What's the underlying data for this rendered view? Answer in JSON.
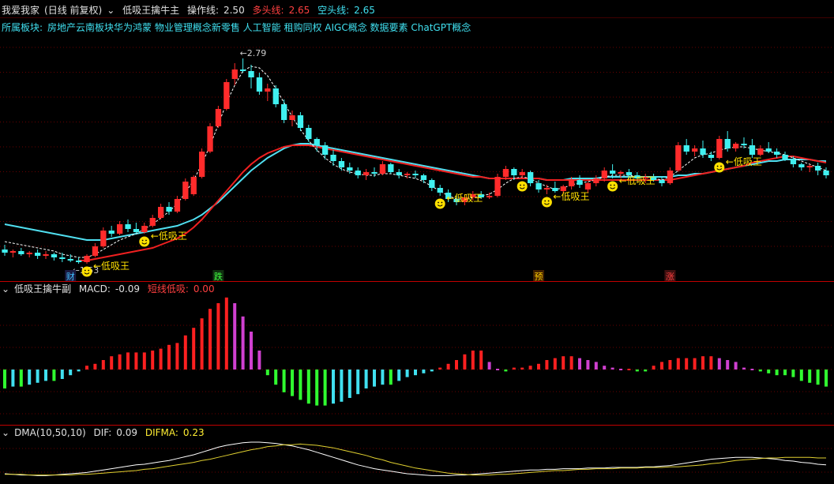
{
  "header": {
    "stock_name": "我爱我家",
    "period": "(日线 前复权)",
    "indicator_name": "低吸王擒牛主",
    "op_label": "操作线:",
    "op_value": "2.50",
    "bull_label": "多头线:",
    "bull_value": "2.65",
    "bear_label": "空头线:",
    "bear_value": "2.65"
  },
  "concepts": {
    "label": "所属板块:",
    "items": "房地产云南板块华为鸿蒙 物业管理概念新零售 人工智能 租购同权 AIGC概念 数据要素 ChatGPT概念"
  },
  "colors": {
    "up": "#ff2b2b",
    "down": "#40f0f0",
    "grid": "#8b0000",
    "bull_line": "#f02020",
    "bear_line": "#50dff0",
    "signal": "#ffe000",
    "macd_pos_strong": "#ff2020",
    "macd_pos_weak": "#d040d0",
    "macd_neg_strong": "#30ff30",
    "macd_neg_weak": "#40e0f0"
  },
  "sub1": {
    "title": "低吸王擒牛副",
    "macd_label": "MACD:",
    "macd_value": "-0.09",
    "short_label": "短线低吸:",
    "short_value": "0.00"
  },
  "sub2": {
    "title": "DMA(10,50,10)",
    "dif_label": "DIF:",
    "dif_value": "0.09",
    "difma_label": "DIFMA:",
    "difma_value": "0.23"
  },
  "chart_data": {
    "type": "candlestick",
    "price_range": [
      1.45,
      2.95
    ],
    "max_label": "2.79",
    "min_label": "1.53",
    "candles": [
      [
        1.58,
        1.61,
        1.54,
        1.56
      ],
      [
        1.56,
        1.58,
        1.53,
        1.57
      ],
      [
        1.57,
        1.59,
        1.54,
        1.55
      ],
      [
        1.55,
        1.57,
        1.53,
        1.56
      ],
      [
        1.56,
        1.58,
        1.52,
        1.54
      ],
      [
        1.54,
        1.57,
        1.52,
        1.55
      ],
      [
        1.55,
        1.56,
        1.51,
        1.53
      ],
      [
        1.53,
        1.56,
        1.5,
        1.52
      ],
      [
        1.52,
        1.55,
        1.5,
        1.51
      ],
      [
        1.51,
        1.53,
        1.49,
        1.5
      ],
      [
        1.5,
        1.55,
        1.49,
        1.54
      ],
      [
        1.54,
        1.62,
        1.53,
        1.6
      ],
      [
        1.6,
        1.72,
        1.59,
        1.7
      ],
      [
        1.7,
        1.73,
        1.66,
        1.68
      ],
      [
        1.68,
        1.76,
        1.67,
        1.74
      ],
      [
        1.74,
        1.77,
        1.69,
        1.71
      ],
      [
        1.71,
        1.75,
        1.68,
        1.69
      ],
      [
        1.69,
        1.75,
        1.68,
        1.73
      ],
      [
        1.73,
        1.8,
        1.72,
        1.78
      ],
      [
        1.78,
        1.87,
        1.77,
        1.85
      ],
      [
        1.85,
        1.88,
        1.8,
        1.82
      ],
      [
        1.82,
        1.92,
        1.81,
        1.9
      ],
      [
        1.9,
        2.03,
        1.89,
        2.01
      ],
      [
        1.93,
        2.05,
        1.92,
        2.04
      ],
      [
        2.04,
        2.22,
        2.03,
        2.2
      ],
      [
        2.2,
        2.38,
        2.19,
        2.36
      ],
      [
        2.36,
        2.49,
        2.35,
        2.47
      ],
      [
        2.47,
        2.66,
        2.46,
        2.64
      ],
      [
        2.66,
        2.76,
        2.62,
        2.72
      ],
      [
        2.72,
        2.79,
        2.7,
        2.71
      ],
      [
        2.71,
        2.75,
        2.6,
        2.67
      ],
      [
        2.67,
        2.7,
        2.56,
        2.58
      ],
      [
        2.58,
        2.63,
        2.52,
        2.6
      ],
      [
        2.6,
        2.62,
        2.48,
        2.5
      ],
      [
        2.5,
        2.53,
        2.38,
        2.4
      ],
      [
        2.4,
        2.46,
        2.36,
        2.43
      ],
      [
        2.43,
        2.45,
        2.33,
        2.35
      ],
      [
        2.35,
        2.37,
        2.26,
        2.28
      ],
      [
        2.28,
        2.29,
        2.2,
        2.24
      ],
      [
        2.24,
        2.26,
        2.15,
        2.18
      ],
      [
        2.18,
        2.21,
        2.11,
        2.14
      ],
      [
        2.14,
        2.16,
        2.08,
        2.1
      ],
      [
        2.1,
        2.13,
        2.06,
        2.08
      ],
      [
        2.08,
        2.1,
        2.03,
        2.05
      ],
      [
        2.05,
        2.09,
        2.02,
        2.07
      ],
      [
        2.07,
        2.1,
        2.04,
        2.06
      ],
      [
        2.06,
        2.14,
        2.05,
        2.12
      ],
      [
        2.12,
        2.13,
        2.06,
        2.07
      ],
      [
        2.07,
        2.09,
        2.03,
        2.05
      ],
      [
        2.05,
        2.07,
        2.03,
        2.06
      ],
      [
        2.06,
        2.08,
        2.03,
        2.05
      ],
      [
        2.05,
        2.06,
        2.0,
        2.02
      ],
      [
        2.02,
        2.03,
        1.95,
        1.97
      ],
      [
        1.97,
        1.99,
        1.92,
        1.94
      ],
      [
        1.94,
        1.96,
        1.88,
        1.9
      ],
      [
        1.9,
        1.92,
        1.86,
        1.88
      ],
      [
        1.88,
        1.93,
        1.86,
        1.91
      ],
      [
        1.91,
        1.95,
        1.89,
        1.93
      ],
      [
        1.93,
        1.95,
        1.9,
        1.91
      ],
      [
        1.91,
        1.94,
        1.9,
        1.92
      ],
      [
        1.92,
        2.06,
        1.91,
        2.04
      ],
      [
        2.04,
        2.11,
        2.02,
        2.09
      ],
      [
        2.09,
        2.1,
        2.02,
        2.05
      ],
      [
        2.05,
        2.09,
        2.03,
        2.07
      ],
      [
        2.07,
        2.08,
        1.98,
        2.0
      ],
      [
        2.0,
        2.02,
        1.94,
        1.96
      ],
      [
        1.96,
        1.99,
        1.93,
        1.97
      ],
      [
        1.97,
        2.01,
        1.94,
        1.95
      ],
      [
        1.95,
        1.99,
        1.93,
        1.98
      ],
      [
        1.98,
        2.04,
        1.96,
        2.02
      ],
      [
        2.02,
        2.05,
        1.97,
        1.99
      ],
      [
        1.96,
        2.01,
        1.94,
        2.0
      ],
      [
        2.0,
        2.05,
        1.98,
        2.03
      ],
      [
        2.03,
        2.1,
        2.01,
        2.08
      ],
      [
        2.08,
        2.12,
        2.03,
        2.06
      ],
      [
        2.06,
        2.08,
        2.03,
        2.07
      ],
      [
        2.07,
        2.09,
        2.03,
        2.05
      ],
      [
        2.05,
        2.07,
        2.01,
        2.03
      ],
      [
        2.03,
        2.06,
        2.0,
        2.04
      ],
      [
        2.04,
        2.06,
        2.01,
        2.02
      ],
      [
        2.02,
        2.04,
        1.98,
        2.0
      ],
      [
        2.0,
        2.1,
        1.99,
        2.08
      ],
      [
        2.08,
        2.26,
        2.07,
        2.24
      ],
      [
        2.24,
        2.28,
        2.18,
        2.2
      ],
      [
        2.2,
        2.24,
        2.17,
        2.22
      ],
      [
        2.22,
        2.27,
        2.16,
        2.18
      ],
      [
        2.18,
        2.2,
        2.14,
        2.16
      ],
      [
        2.16,
        2.3,
        2.15,
        2.28
      ],
      [
        2.28,
        2.33,
        2.2,
        2.22
      ],
      [
        2.22,
        2.26,
        2.2,
        2.25
      ],
      [
        2.25,
        2.29,
        2.22,
        2.24
      ],
      [
        2.24,
        2.28,
        2.16,
        2.18
      ],
      [
        2.18,
        2.24,
        2.17,
        2.22
      ],
      [
        2.22,
        2.26,
        2.19,
        2.2
      ],
      [
        2.2,
        2.22,
        2.16,
        2.18
      ],
      [
        2.18,
        2.2,
        2.14,
        2.15
      ],
      [
        2.15,
        2.17,
        2.1,
        2.12
      ],
      [
        2.12,
        2.13,
        2.08,
        2.1
      ],
      [
        2.1,
        2.12,
        2.07,
        2.11
      ],
      [
        2.11,
        2.13,
        2.05,
        2.08
      ],
      [
        2.08,
        2.1,
        2.03,
        2.05
      ]
    ],
    "bear_line": [
      1.74,
      1.73,
      1.72,
      1.71,
      1.7,
      1.69,
      1.68,
      1.67,
      1.66,
      1.65,
      1.64,
      1.64,
      1.64,
      1.65,
      1.66,
      1.67,
      1.68,
      1.69,
      1.7,
      1.71,
      1.72,
      1.73,
      1.75,
      1.77,
      1.8,
      1.84,
      1.88,
      1.93,
      1.98,
      2.03,
      2.08,
      2.12,
      2.16,
      2.19,
      2.22,
      2.24,
      2.25,
      2.25,
      2.24,
      2.23,
      2.22,
      2.21,
      2.2,
      2.19,
      2.18,
      2.17,
      2.16,
      2.15,
      2.14,
      2.13,
      2.12,
      2.11,
      2.1,
      2.09,
      2.08,
      2.07,
      2.06,
      2.05,
      2.04,
      2.03,
      2.03,
      2.03,
      2.03,
      2.03,
      2.03,
      2.03,
      2.02,
      2.02,
      2.02,
      2.03,
      2.03,
      2.03,
      2.03,
      2.04,
      2.04,
      2.04,
      2.04,
      2.04,
      2.04,
      2.04,
      2.04,
      2.04,
      2.05,
      2.05,
      2.06,
      2.06,
      2.07,
      2.08,
      2.09,
      2.1,
      2.11,
      2.12,
      2.13,
      2.14,
      2.14,
      2.15,
      2.15,
      2.15,
      2.15,
      2.14,
      2.14
    ],
    "bull_line": [
      null,
      null,
      null,
      null,
      null,
      null,
      null,
      null,
      null,
      1.51,
      1.51,
      1.52,
      1.53,
      1.54,
      1.55,
      1.56,
      1.57,
      1.58,
      1.59,
      1.61,
      1.63,
      1.65,
      1.68,
      1.72,
      1.77,
      1.83,
      1.89,
      1.95,
      2.01,
      2.07,
      2.12,
      2.16,
      2.19,
      2.21,
      2.23,
      2.24,
      2.24,
      2.24,
      2.23,
      2.22,
      2.21,
      2.2,
      2.19,
      2.18,
      2.17,
      2.16,
      2.15,
      2.14,
      2.13,
      2.12,
      2.11,
      2.1,
      2.09,
      2.08,
      2.07,
      2.06,
      2.05,
      2.04,
      2.04,
      2.03,
      2.03,
      2.03,
      2.03,
      2.03,
      2.03,
      2.03,
      2.02,
      2.02,
      2.02,
      2.02,
      2.02,
      2.02,
      2.02,
      2.02,
      2.02,
      2.02,
      2.02,
      2.02,
      2.02,
      2.02,
      2.02,
      2.02,
      2.03,
      2.04,
      2.05,
      2.06,
      2.07,
      2.08,
      2.09,
      2.1,
      2.11,
      2.13,
      2.14,
      2.15,
      2.16,
      2.17,
      2.17,
      2.16,
      2.15,
      2.14,
      2.13
    ],
    "op_line": [
      1.63,
      1.62,
      1.61,
      1.6,
      1.59,
      1.58,
      1.57,
      1.55,
      1.54,
      1.53,
      1.53,
      1.55,
      1.58,
      1.61,
      1.64,
      1.66,
      1.68,
      1.71,
      1.74,
      1.78,
      1.82,
      1.87,
      1.94,
      2.02,
      2.12,
      2.24,
      2.37,
      2.51,
      2.62,
      2.71,
      2.74,
      2.73,
      2.68,
      2.6,
      2.51,
      2.42,
      2.34,
      2.27,
      2.21,
      2.16,
      2.12,
      2.09,
      2.07,
      2.06,
      2.05,
      2.05,
      2.06,
      2.06,
      2.05,
      2.04,
      2.03,
      2.01,
      1.98,
      1.95,
      1.92,
      1.9,
      1.9,
      1.91,
      1.92,
      1.93,
      1.96,
      2.0,
      2.03,
      2.04,
      2.03,
      2.0,
      1.98,
      1.96,
      1.97,
      1.99,
      2.0,
      2.01,
      2.02,
      2.04,
      2.05,
      2.05,
      2.05,
      2.04,
      2.04,
      2.03,
      2.02,
      2.04,
      2.08,
      2.12,
      2.16,
      2.18,
      2.19,
      2.21,
      2.22,
      2.23,
      2.23,
      2.22,
      2.21,
      2.2,
      2.19,
      2.18,
      2.16,
      2.14,
      2.12,
      2.1,
      2.08
    ],
    "signals": [
      {
        "i": 10,
        "label": "低吸王"
      },
      {
        "i": 17,
        "label": "低吸王"
      },
      {
        "i": 53,
        "label": "低吸王"
      },
      {
        "i": 63,
        "label": ""
      },
      {
        "i": 66,
        "label": "低吸王"
      },
      {
        "i": 74,
        "label": "低吸王"
      },
      {
        "i": 87,
        "label": "低吸王"
      }
    ],
    "events": [
      {
        "i": 8,
        "label": "财",
        "color": "#40c0ff",
        "bg": "#1a1a40"
      },
      {
        "i": 26,
        "label": "跌",
        "color": "#40ff40",
        "bg": "#103010"
      },
      {
        "i": 65,
        "label": "预",
        "color": "#ffcc00",
        "bg": "#402000"
      },
      {
        "i": 81,
        "label": "涨",
        "color": "#ff4040",
        "bg": "#401010"
      }
    ],
    "macd": [
      -0.1,
      -0.09,
      -0.09,
      -0.08,
      -0.07,
      -0.06,
      -0.06,
      -0.05,
      -0.03,
      -0.01,
      0.02,
      0.03,
      0.05,
      0.07,
      0.08,
      0.09,
      0.09,
      0.09,
      0.1,
      0.11,
      0.13,
      0.14,
      0.18,
      0.22,
      0.27,
      0.32,
      0.35,
      0.38,
      0.35,
      0.28,
      0.2,
      0.1,
      -0.03,
      -0.08,
      -0.12,
      -0.14,
      -0.16,
      -0.18,
      -0.19,
      -0.19,
      -0.18,
      -0.17,
      -0.15,
      -0.13,
      -0.1,
      -0.09,
      -0.08,
      -0.08,
      -0.06,
      -0.04,
      -0.03,
      -0.02,
      -0.01,
      0.01,
      0.03,
      0.05,
      0.08,
      0.1,
      0.1,
      0.04,
      0.0,
      -0.01,
      0.01,
      0.01,
      0.02,
      0.03,
      0.05,
      0.06,
      0.07,
      0.07,
      0.06,
      0.05,
      0.04,
      0.02,
      0.01,
      0.0,
      0.0,
      -0.01,
      -0.01,
      0.02,
      0.04,
      0.05,
      0.06,
      0.06,
      0.06,
      0.07,
      0.07,
      0.06,
      0.05,
      0.04,
      0.01,
      0.0,
      -0.01,
      -0.02,
      -0.03,
      -0.03,
      -0.04,
      -0.06,
      -0.07,
      -0.08,
      -0.09
    ],
    "dif": [
      -0.05,
      -0.06,
      -0.07,
      -0.07,
      -0.08,
      -0.08,
      -0.07,
      -0.06,
      -0.05,
      -0.04,
      -0.03,
      -0.01,
      0.01,
      0.03,
      0.05,
      0.07,
      0.09,
      0.1,
      0.12,
      0.14,
      0.16,
      0.19,
      0.22,
      0.25,
      0.29,
      0.33,
      0.37,
      0.4,
      0.42,
      0.44,
      0.45,
      0.45,
      0.44,
      0.43,
      0.41,
      0.39,
      0.36,
      0.33,
      0.29,
      0.25,
      0.21,
      0.17,
      0.13,
      0.09,
      0.06,
      0.03,
      0.01,
      -0.01,
      -0.03,
      -0.05,
      -0.06,
      -0.07,
      -0.08,
      -0.08,
      -0.08,
      -0.07,
      -0.07,
      -0.06,
      -0.05,
      -0.04,
      -0.03,
      -0.02,
      -0.01,
      0.0,
      0.01,
      0.01,
      0.02,
      0.02,
      0.03,
      0.03,
      0.03,
      0.04,
      0.04,
      0.04,
      0.05,
      0.05,
      0.05,
      0.05,
      0.06,
      0.06,
      0.07,
      0.08,
      0.1,
      0.12,
      0.14,
      0.16,
      0.18,
      0.19,
      0.2,
      0.21,
      0.21,
      0.21,
      0.2,
      0.19,
      0.18,
      0.16,
      0.15,
      0.13,
      0.12,
      0.1,
      0.09
    ],
    "difma": [
      -0.06,
      -0.06,
      -0.06,
      -0.07,
      -0.07,
      -0.07,
      -0.07,
      -0.07,
      -0.07,
      -0.06,
      -0.06,
      -0.05,
      -0.04,
      -0.03,
      -0.02,
      -0.01,
      0.0,
      0.02,
      0.03,
      0.05,
      0.07,
      0.09,
      0.11,
      0.13,
      0.16,
      0.18,
      0.21,
      0.24,
      0.27,
      0.3,
      0.33,
      0.35,
      0.38,
      0.39,
      0.41,
      0.41,
      0.42,
      0.41,
      0.4,
      0.38,
      0.36,
      0.33,
      0.3,
      0.27,
      0.24,
      0.2,
      0.17,
      0.13,
      0.1,
      0.07,
      0.04,
      0.02,
      0.0,
      -0.02,
      -0.04,
      -0.05,
      -0.06,
      -0.07,
      -0.07,
      -0.07,
      -0.06,
      -0.06,
      -0.05,
      -0.04,
      -0.03,
      -0.02,
      -0.01,
      0.0,
      0.0,
      0.01,
      0.02,
      0.02,
      0.03,
      0.03,
      0.03,
      0.04,
      0.04,
      0.04,
      0.05,
      0.05,
      0.05,
      0.06,
      0.06,
      0.07,
      0.08,
      0.09,
      0.11,
      0.12,
      0.14,
      0.16,
      0.17,
      0.18,
      0.19,
      0.2,
      0.2,
      0.21,
      0.21,
      0.21,
      0.21,
      0.2,
      0.2
    ]
  }
}
